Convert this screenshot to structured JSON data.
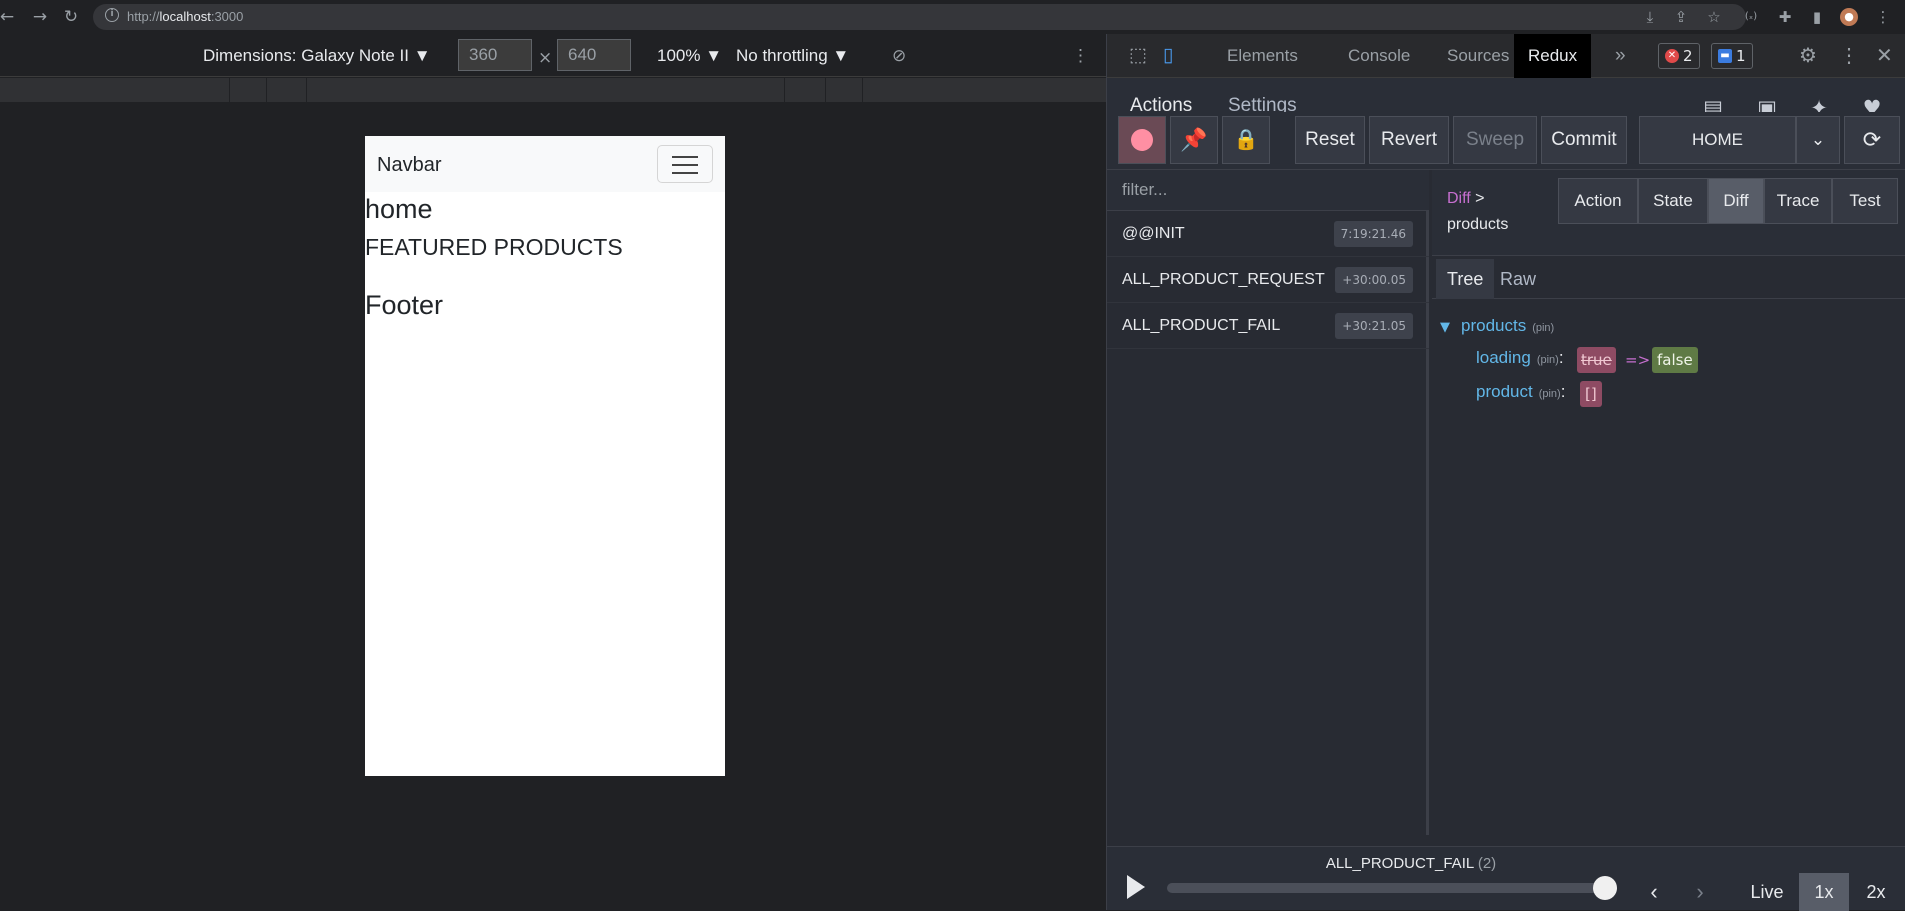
{
  "browser": {
    "url_prefix": "http://",
    "url_host": "localhost",
    "url_port": ":3000"
  },
  "device_toolbar": {
    "dimensions_label": "Dimensions: Galaxy Note II ▼",
    "width": "360",
    "height": "640",
    "times": "×",
    "zoom": "100% ▼",
    "throttling": "No throttling ▼"
  },
  "page": {
    "navbar_brand": "Navbar",
    "home": "home",
    "featured": "FEATURED PRODUCTS",
    "footer": "Footer"
  },
  "devtools": {
    "tabs": [
      "Elements",
      "Console",
      "Sources",
      "Redux"
    ],
    "active_tab": "Redux",
    "error_count": "2",
    "message_count": "1"
  },
  "redux": {
    "subtabs": [
      "Actions",
      "Settings"
    ],
    "toolbar": {
      "reset": "Reset",
      "revert": "Revert",
      "sweep": "Sweep",
      "commit": "Commit",
      "instance": "HOME"
    },
    "filter_placeholder": "filter...",
    "actions": [
      {
        "name": "@@INIT",
        "time": "7:19:21.46"
      },
      {
        "name": "ALL_PRODUCT_REQUEST",
        "time": "+30:00.05"
      },
      {
        "name": "ALL_PRODUCT_FAIL",
        "time": "+30:21.05"
      }
    ],
    "breadcrumb": {
      "root": "Diff",
      "sep": ">",
      "leaf": "products"
    },
    "view_buttons": [
      "Action",
      "State",
      "Diff",
      "Trace",
      "Test"
    ],
    "active_view": "Diff",
    "format_tabs": [
      "Tree",
      "Raw"
    ],
    "tree": {
      "root_key": "products",
      "pin": "(pin)",
      "rows": [
        {
          "key": "loading",
          "old": "true",
          "arrow": "=>",
          "new": "false"
        },
        {
          "key": "product",
          "new": "[]"
        }
      ]
    },
    "slider": {
      "current_action": "ALL_PRODUCT_FAIL",
      "current_index": "(2)",
      "position": 1.0,
      "live": "Live",
      "speeds": [
        "1x",
        "2x"
      ]
    }
  }
}
